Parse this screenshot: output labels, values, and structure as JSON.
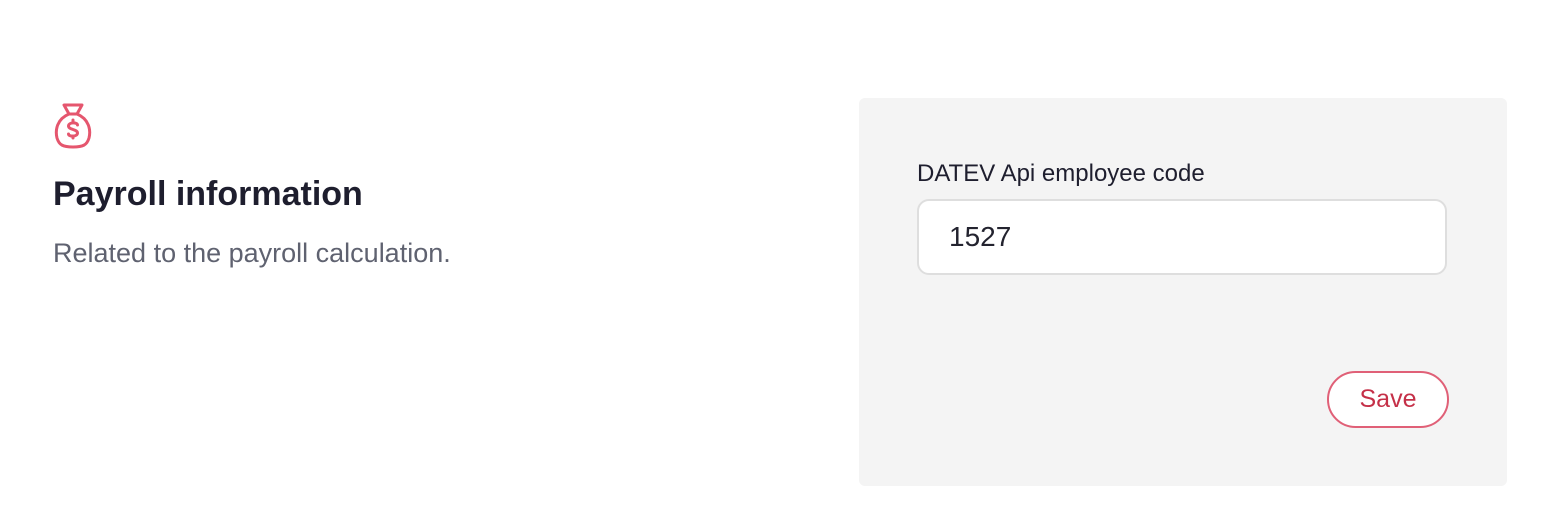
{
  "section": {
    "icon": "money-bag-icon",
    "title": "Payroll information",
    "subtitle": "Related to the payroll calculation."
  },
  "form": {
    "field_label": "DATEV Api employee code",
    "field_value": "1527",
    "save_label": "Save"
  },
  "colors": {
    "accent": "#e5566e",
    "accent_text": "#c53048",
    "panel_bg": "#f4f4f4",
    "title_text": "#1e1e2e",
    "subtitle_text": "#5f6270"
  }
}
